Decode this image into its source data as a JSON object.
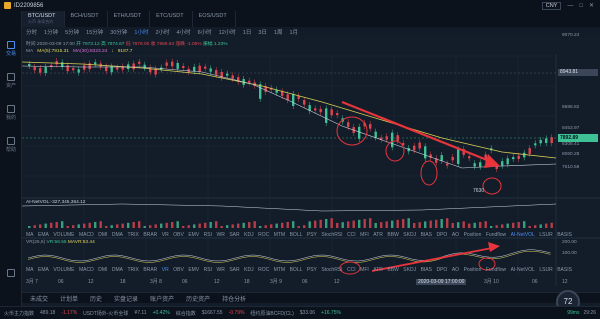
{
  "titlebar": {
    "uid": "ID2209856",
    "currency": "CNY"
  },
  "rail": [
    {
      "label": "交易",
      "active": true
    },
    {
      "label": "资产",
      "active": false
    },
    {
      "label": "我的",
      "active": false
    },
    {
      "label": "帮助",
      "active": false
    }
  ],
  "tabs": [
    {
      "label": "BTC/USDT",
      "sub": "火币 永续合约"
    },
    {
      "label": "BCH/USDT",
      "sub": ""
    },
    {
      "label": "ETH/USDT",
      "sub": ""
    },
    {
      "label": "ETC/USDT",
      "sub": ""
    },
    {
      "label": "EOS/USDT",
      "sub": ""
    }
  ],
  "timeframes": [
    "分时",
    "1分钟",
    "5分钟",
    "15分钟",
    "30分钟",
    "1小时",
    "2小时",
    "4小时",
    "6小时",
    "12小时",
    "1日",
    "3日",
    "1周",
    "1月"
  ],
  "active_timeframe": "1小时",
  "ohlc": {
    "time": "时间 2020-03-09 17:00",
    "open": "开 7973.12",
    "high": "高 7974.67",
    "low": "低 7878.00",
    "close": "收 7888.83",
    "chg": "涨跌 -1.05%",
    "amp": "振幅 1.23%"
  },
  "ma": {
    "label": "MA",
    "ma5": "MA(5):7915.31",
    "ma30": "MA(30):8323.24",
    "arrow": "↓",
    "ma5_val": "9187.7"
  },
  "price_labels": [
    "9070.24",
    "8943.81",
    "8688.82",
    "8453.97",
    "8308.41",
    "8060.28",
    "7852.40",
    "7610.58"
  ],
  "last_price": "7892.89",
  "mark_price": "8943.81",
  "low_marker": "7630",
  "volume_label": "AI-NetVOL:-327,345,364.12",
  "indicators_1": [
    "MA",
    "EMA",
    "VOLUME",
    "MACD",
    "DMI",
    "DMA",
    "TRIX",
    "BRAR",
    "VR",
    "OBV",
    "EMV",
    "RSI",
    "WR",
    "SAR",
    "KDJ",
    "ROC",
    "MTM",
    "BOLL",
    "PSY",
    "StochRSI",
    "CCI",
    "MFI",
    "ATR",
    "BBW",
    "SKDJ",
    "BIAS",
    "DPO",
    "AO",
    "Position",
    "Fundflow",
    "AI-NetVOL",
    "LSUR",
    "BASIS"
  ],
  "indicators_1_active": "AI-NetVOL",
  "vr_label": {
    "name": "VR(26,6)",
    "vr": "VR:56.55",
    "mavr": "MAVR:53.44"
  },
  "vr_levels": [
    "200.00",
    "100.00"
  ],
  "indicators_2": [
    "MA",
    "EMA",
    "VOLUME",
    "MACD",
    "DMI",
    "DMA",
    "TRIX",
    "BRAR",
    "VR",
    "OBV",
    "EMV",
    "RSI",
    "WR",
    "SAR",
    "KDJ",
    "ROC",
    "MTM",
    "BOLL",
    "PSY",
    "StochRSI",
    "CCI",
    "MFI",
    "ATR",
    "BBW",
    "SKDJ",
    "BIAS",
    "DPO",
    "AO",
    "Position",
    "Fundflow",
    "AI-NetVOL",
    "LSUR",
    "BASIS"
  ],
  "indicators_2_active": "VR",
  "xaxis": [
    "3月 7",
    "06",
    "12",
    "18",
    "3月 8",
    "06",
    "12",
    "18",
    "3月 9",
    "06",
    "12",
    "2020-03-09 17:00:00",
    "3月 10",
    "06",
    "12"
  ],
  "panel_tabs": [
    "未成交",
    "计划单",
    "历史",
    "实盘记录",
    "账户资产",
    "历史资产",
    "持仓分析"
  ],
  "ticker": {
    "item1_label": "火币主力指数",
    "item1_val": "489.18",
    "item1_chg": "-1.17%",
    "item2_label": "USDT场外-火币全球",
    "item2_val": "¥7.11",
    "item2_chg": "+0.42%",
    "item3_label": "综合指数",
    "item3_val": "$1667.55",
    "item3_chg": "-0.79%",
    "item4_label": "纽约原油BCFD(CL)",
    "item4_val": "$33.06",
    "item4_chg": "+16.75%",
    "latency": "99ms",
    "time": "29:26"
  },
  "gauge_value": "72",
  "colors": {
    "up": "#3ec195",
    "down": "#e0454f",
    "ma5": "#e0d45a",
    "ma30": "#d66fd6",
    "accent": "#4a8cf0",
    "annotation": "#e8343a"
  }
}
